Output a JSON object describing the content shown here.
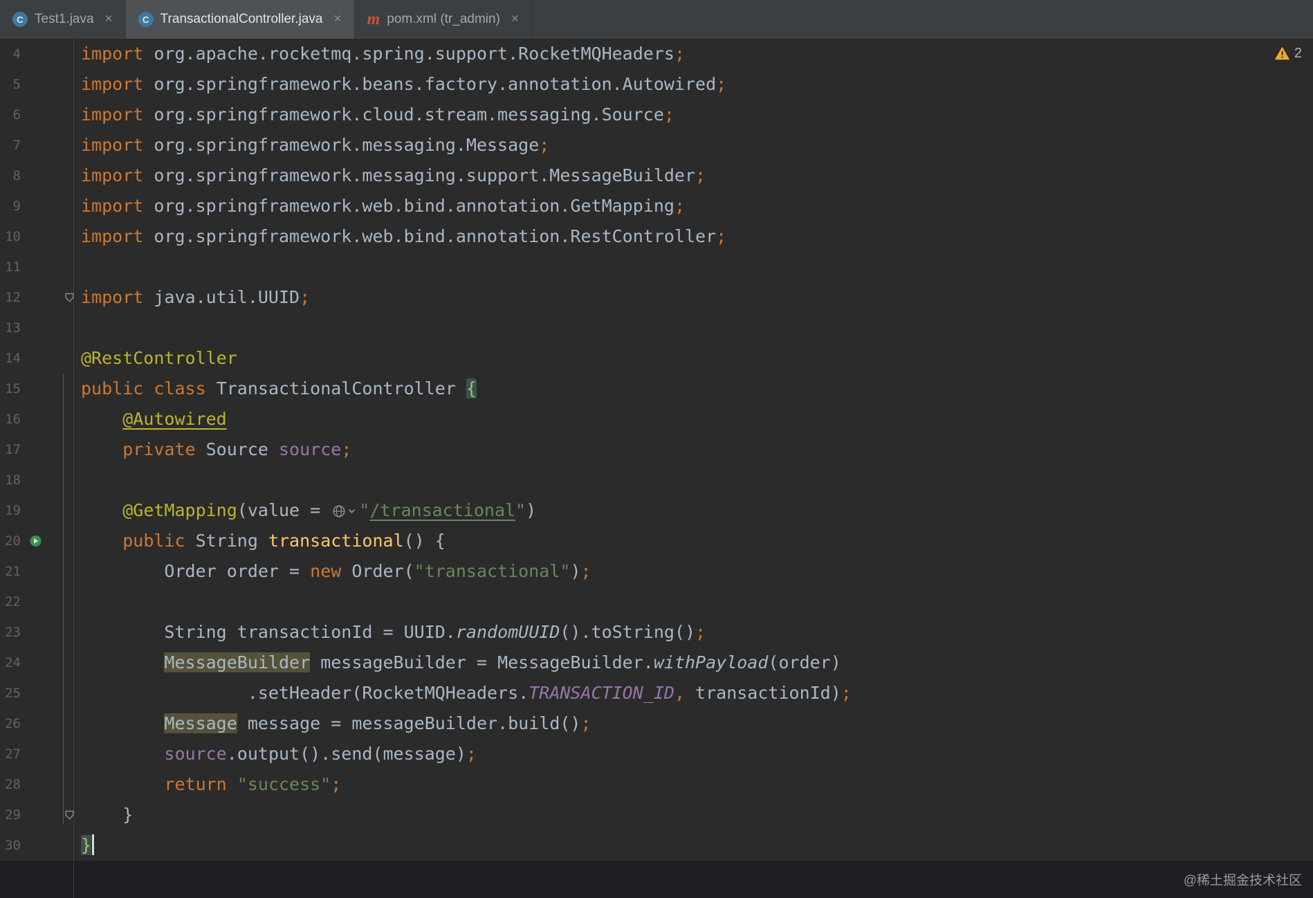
{
  "colors": {
    "editor_bg": "#2b2b2b",
    "band_bg": "#1e1f22",
    "tabbar_bg": "#3c3f41",
    "tab_active_bg": "#4e5254",
    "keyword": "#cc7832",
    "plain": "#a9b7c6",
    "annotation": "#bbb529",
    "string": "#6a8759",
    "method_decl": "#ffc66b",
    "field": "#9876aa",
    "line_number": "#606366",
    "id_highlight": "#56523a",
    "brace_bg": "#3b514d",
    "brace_text": "#a8c063",
    "caret": "#d6d9dd",
    "warning": "#f0a732",
    "gutter_line": "#3c3f41",
    "fold_guide": "#5b5e60"
  },
  "ui": {
    "close_glyph": "×"
  },
  "tabs": [
    {
      "label": "Test1.java",
      "icon": "C",
      "active": false
    },
    {
      "label": "TransactionalController.java",
      "icon": "C",
      "active": true
    },
    {
      "label": "pom.xml (tr_admin)",
      "icon": "m",
      "active": false
    }
  ],
  "inspection": {
    "warning_count": "2"
  },
  "watermark": "@稀土掘金技术社区",
  "editor": {
    "language": "java",
    "lines": [
      {
        "n": 4,
        "tokens": [
          [
            "import",
            "k"
          ],
          [
            " org.apache.rocketmq.spring.support.RocketMQHeaders",
            "t"
          ],
          [
            ";",
            "k"
          ]
        ]
      },
      {
        "n": 5,
        "tokens": [
          [
            "import",
            "k"
          ],
          [
            " org.springframework.beans.factory.annotation.Autowired",
            "t"
          ],
          [
            ";",
            "k"
          ]
        ]
      },
      {
        "n": 6,
        "tokens": [
          [
            "import",
            "k"
          ],
          [
            " org.springframework.cloud.stream.messaging.Source",
            "t"
          ],
          [
            ";",
            "k"
          ]
        ]
      },
      {
        "n": 7,
        "tokens": [
          [
            "import",
            "k"
          ],
          [
            " org.springframework.messaging.Message",
            "t"
          ],
          [
            ";",
            "k"
          ]
        ]
      },
      {
        "n": 8,
        "tokens": [
          [
            "import",
            "k"
          ],
          [
            " org.springframework.messaging.support.MessageBuilder",
            "t"
          ],
          [
            ";",
            "k"
          ]
        ]
      },
      {
        "n": 9,
        "tokens": [
          [
            "import",
            "k"
          ],
          [
            " org.springframework.web.bind.annotation.GetMapping",
            "t"
          ],
          [
            ";",
            "k"
          ]
        ]
      },
      {
        "n": 10,
        "tokens": [
          [
            "import",
            "k"
          ],
          [
            " org.springframework.web.bind.annotation.RestController",
            "t"
          ],
          [
            ";",
            "k"
          ]
        ]
      },
      {
        "n": 11,
        "tokens": []
      },
      {
        "n": 12,
        "fold": true,
        "tokens": [
          [
            "import",
            "k"
          ],
          [
            " java.util.UUID",
            "t"
          ],
          [
            ";",
            "k"
          ]
        ]
      },
      {
        "n": 13,
        "tokens": []
      },
      {
        "n": 14,
        "tokens": [
          [
            "@RestController",
            "a"
          ]
        ]
      },
      {
        "n": 15,
        "tokens": [
          [
            "public",
            "k"
          ],
          [
            " ",
            "t"
          ],
          [
            "class",
            "k"
          ],
          [
            " TransactionalController ",
            "t"
          ],
          [
            "{",
            "b1"
          ]
        ]
      },
      {
        "n": 16,
        "tokens": [
          [
            "    ",
            "t"
          ],
          [
            "@Autowired",
            "u"
          ]
        ]
      },
      {
        "n": 17,
        "tokens": [
          [
            "    ",
            "t"
          ],
          [
            "private",
            "k"
          ],
          [
            " Source ",
            "t"
          ],
          [
            "source",
            "f"
          ],
          [
            ";",
            "k"
          ]
        ]
      },
      {
        "n": 18,
        "tokens": []
      },
      {
        "n": 19,
        "tokens": [
          [
            "    ",
            "t"
          ],
          [
            "@GetMapping",
            "a"
          ],
          [
            "(value = ",
            "t"
          ],
          [
            "",
            "icon-globe"
          ],
          [
            "\"",
            "s"
          ],
          [
            "/transactional",
            "l"
          ],
          [
            "\"",
            "s"
          ],
          [
            ")",
            "t"
          ]
        ]
      },
      {
        "n": 20,
        "run": true,
        "tokens": [
          [
            "    ",
            "t"
          ],
          [
            "public",
            "k"
          ],
          [
            " String ",
            "t"
          ],
          [
            "transactional",
            "d"
          ],
          [
            "() {",
            "t"
          ]
        ]
      },
      {
        "n": 21,
        "tokens": [
          [
            "        Order order = ",
            "t"
          ],
          [
            "new",
            "k"
          ],
          [
            " Order(",
            "t"
          ],
          [
            "\"transactional\"",
            "s"
          ],
          [
            ")",
            "t"
          ],
          [
            ";",
            "k"
          ]
        ]
      },
      {
        "n": 22,
        "tokens": []
      },
      {
        "n": 23,
        "tokens": [
          [
            "        String transactionId = UUID.",
            "t"
          ],
          [
            "randomUUID",
            "i"
          ],
          [
            "().toString()",
            "t"
          ],
          [
            ";",
            "k"
          ]
        ]
      },
      {
        "n": 24,
        "tokens": [
          [
            "        ",
            "t"
          ],
          [
            "MessageBuilder",
            "h"
          ],
          [
            " messageBuilder = MessageBuilder.",
            "t"
          ],
          [
            "withPayload",
            "i"
          ],
          [
            "(order)",
            "t"
          ]
        ]
      },
      {
        "n": 25,
        "tokens": [
          [
            "                .setHeader(RocketMQHeaders.",
            "t"
          ],
          [
            "TRANSACTION_ID",
            "c"
          ],
          [
            ",",
            "k"
          ],
          [
            " transactionId)",
            "t"
          ],
          [
            ";",
            "k"
          ]
        ]
      },
      {
        "n": 26,
        "tokens": [
          [
            "        ",
            "t"
          ],
          [
            "Message",
            "h"
          ],
          [
            " message = messageBuilder.build()",
            "t"
          ],
          [
            ";",
            "k"
          ]
        ]
      },
      {
        "n": 27,
        "tokens": [
          [
            "        ",
            "t"
          ],
          [
            "source",
            "f"
          ],
          [
            ".output().send(message)",
            "t"
          ],
          [
            ";",
            "k"
          ]
        ]
      },
      {
        "n": 28,
        "tokens": [
          [
            "        ",
            "t"
          ],
          [
            "return",
            "k"
          ],
          [
            " ",
            "t"
          ],
          [
            "\"success\"",
            "s"
          ],
          [
            ";",
            "k"
          ]
        ]
      },
      {
        "n": 29,
        "fold": true,
        "tokens": [
          [
            "    }",
            "t"
          ]
        ]
      },
      {
        "n": 30,
        "tokens": [
          [
            "}",
            "b1"
          ],
          [
            "",
            "caret"
          ]
        ]
      }
    ]
  }
}
